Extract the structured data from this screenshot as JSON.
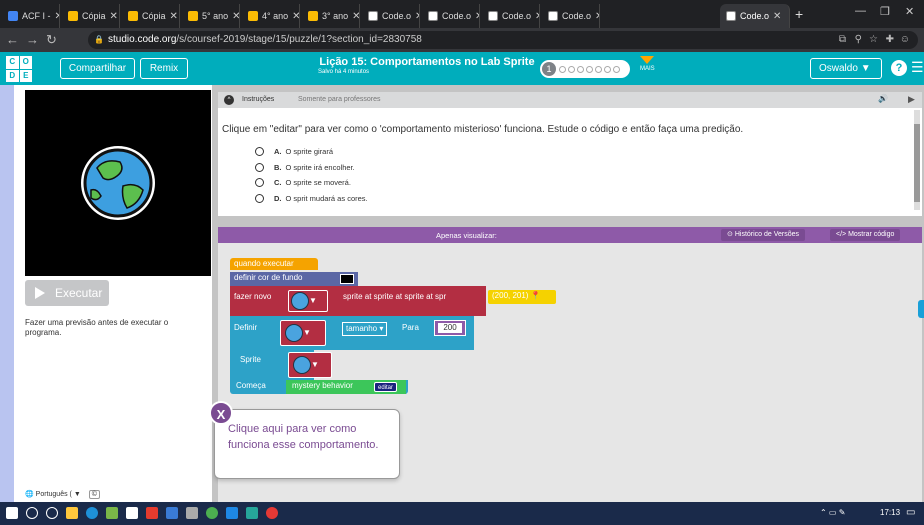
{
  "browser": {
    "tabs": [
      {
        "label": "ACF I -",
        "color": "#4285f4"
      },
      {
        "label": "Cópia",
        "color": "#fbbc05"
      },
      {
        "label": "Cópia",
        "color": "#fbbc05"
      },
      {
        "label": "5° ano",
        "color": "#fbbc05"
      },
      {
        "label": "4° ano",
        "color": "#fbbc05"
      },
      {
        "label": "3° ano",
        "color": "#fbbc05"
      },
      {
        "label": "Code.o",
        "color": "#ffffff"
      },
      {
        "label": "Code.o",
        "color": "#ffffff"
      },
      {
        "label": "Code.o",
        "color": "#ffffff"
      },
      {
        "label": "Code.o",
        "color": "#ffffff"
      },
      {
        "label": "Code.o",
        "color": "#ffffff"
      }
    ],
    "url_domain": "studio.code.org",
    "url_path": "/s/coursef-2019/stage/15/puzzle/1?section_id=2830758"
  },
  "header": {
    "logo_letters": [
      "C",
      "O",
      "D",
      "E"
    ],
    "share_label": "Compartilhar",
    "remix_label": "Remix",
    "lesson_title": "Lição 15: Comportamentos no Lab Sprite",
    "saved_label": "Salvo há 4 minutos",
    "progress_number": "1",
    "more_label": "MAIS",
    "user_label": "Oswaldo",
    "help_label": "?"
  },
  "left": {
    "run_label": "Executar",
    "predict_text": "Fazer uma previsão antes de executar o programa.",
    "language_label": "Português ("
  },
  "instructions": {
    "tab_label": "Instruções",
    "teacher_label": "Somente para professores",
    "text": "Clique em \"editar\" para ver como o 'comportamento misterioso' funciona. Estude o código e então faça uma predição.",
    "options": [
      {
        "letter": "A.",
        "text": "O sprite girará"
      },
      {
        "letter": "B.",
        "text": "O sprite irá encolher."
      },
      {
        "letter": "C.",
        "text": "O sprite se moverá."
      },
      {
        "letter": "D.",
        "text": "O sprit mudará as cores."
      }
    ]
  },
  "workspace": {
    "view_only_label": "Apenas visualizar:",
    "history_label": "Histórico de Versões",
    "show_code_label": "</> Mostrar código",
    "blocks": {
      "when_run": "quando executar",
      "set_background": "definir cor de fundo",
      "make_new": "fazer novo",
      "sprite_at": "sprite at sprite at sprite at spr",
      "coords": "(200, 201)",
      "define": "Definir",
      "size_label": "tamanho",
      "to_label": "Para",
      "size_value": "200",
      "sprite_label": "Sprite",
      "begin_label": "Começa",
      "behavior_label": "mystery behavior",
      "edit_label": "editar"
    }
  },
  "tooltip": {
    "close_label": "X",
    "text": "Clique aqui para ver como funciona esse comportamento."
  },
  "taskbar": {
    "time": "17:13"
  }
}
